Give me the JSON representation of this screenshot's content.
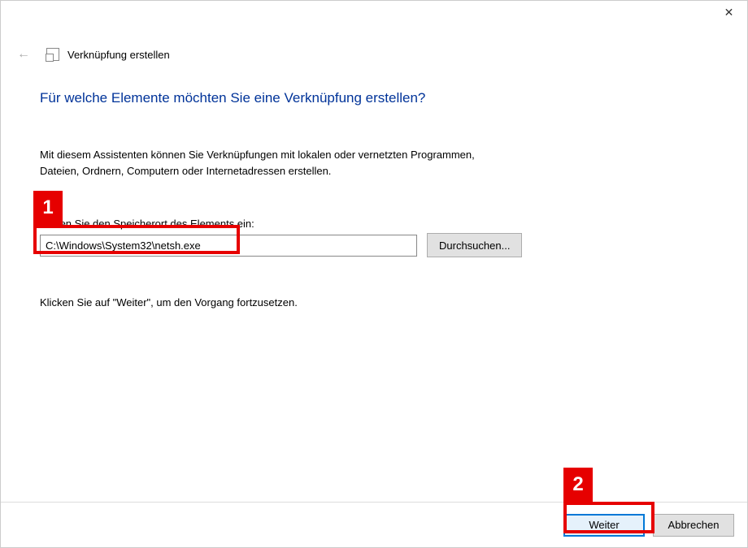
{
  "window": {
    "close_symbol": "✕"
  },
  "header": {
    "back_icon": "←",
    "wizard_title": "Verknüpfung erstellen"
  },
  "content": {
    "heading": "Für welche Elemente möchten Sie eine Verknüpfung erstellen?",
    "description_line1": "Mit diesem Assistenten können Sie Verknüpfungen mit lokalen oder vernetzten Programmen,",
    "description_line2": "Dateien, Ordnern, Computern oder Internetadressen erstellen.",
    "location_label_prefix": "en Sie den Speicherort des Elements ein:",
    "location_label_full": "Geben Sie den Speicherort des Elements ein:",
    "location_value": "C:\\Windows\\System32\\netsh.exe",
    "browse_label": "Durchsuchen...",
    "continue_hint": "Klicken Sie auf \"Weiter\", um den Vorgang fortzusetzen."
  },
  "footer": {
    "next_label": "Weiter",
    "cancel_label": "Abbrechen"
  },
  "callouts": {
    "one": "1",
    "two": "2"
  }
}
